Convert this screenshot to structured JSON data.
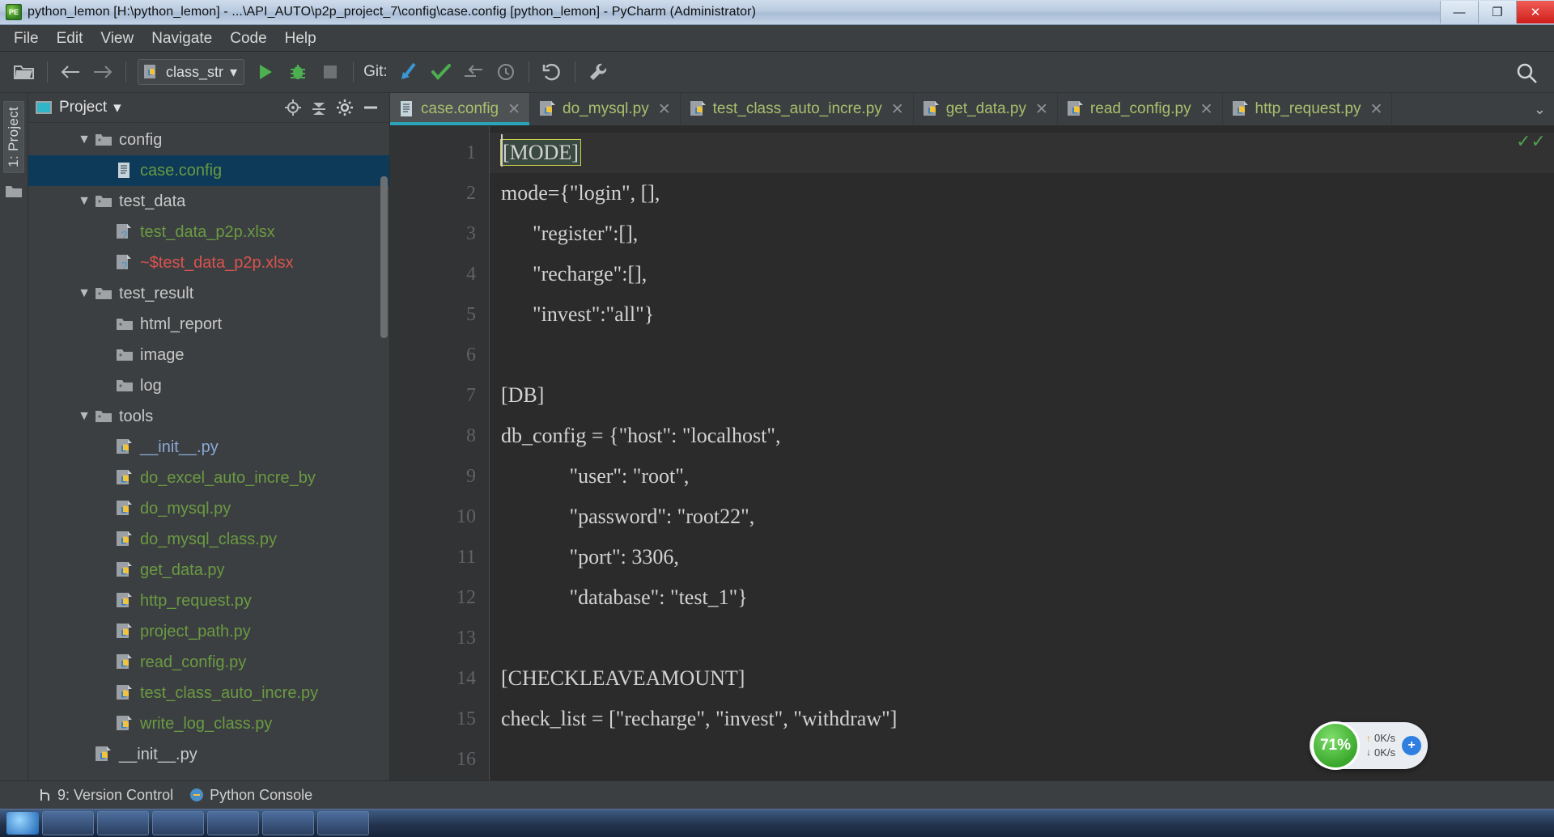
{
  "window": {
    "title": "python_lemon [H:\\python_lemon] - ...\\API_AUTO\\p2p_project_7\\config\\case.config [python_lemon] - PyCharm (Administrator)",
    "app_icon": "pycharm-icon",
    "minimize_label": "—",
    "maximize_label": "❐",
    "close_label": "✕"
  },
  "menubar": {
    "items": [
      {
        "label": "File"
      },
      {
        "label": "Edit"
      },
      {
        "label": "View"
      },
      {
        "label": "Navigate"
      },
      {
        "label": "Code"
      },
      {
        "label": "Help"
      }
    ]
  },
  "toolbar": {
    "open_label": "open-folder-icon",
    "back_label": "back-arrow-icon",
    "forward_label": "forward-arrow-icon",
    "run_config": {
      "name": "class_str",
      "icon": "python-file-icon",
      "chevron": "▾"
    },
    "run_label": "run-icon",
    "debug_label": "debug-icon",
    "stop_label": "stop-icon",
    "git_label": "Git:",
    "git_update_label": "git-update-icon",
    "git_commit_label": "git-commit-icon",
    "git_push_label": "git-push-icon",
    "git_history_label": "git-history-icon",
    "undo_label": "undo-icon",
    "wrench_label": "wrench-icon",
    "search_label": "search-icon"
  },
  "left_strip": {
    "project_tab": "1: Project",
    "folder_icon": "folder-icon"
  },
  "project_panel": {
    "title": "Project",
    "chevron": "▾",
    "panel_icon": "project-panel-icon",
    "tool_locate": "locate-icon",
    "tool_collapse": "collapse-all-icon",
    "tool_settings": "gear-icon",
    "tool_hide": "hide-icon",
    "tree": [
      {
        "label": "config",
        "indent": 2,
        "type": "folder",
        "twisty": "▼",
        "color": "grey",
        "selected": false
      },
      {
        "label": "case.config",
        "indent": 3,
        "type": "config",
        "twisty": "",
        "color": "green",
        "selected": true
      },
      {
        "label": "test_data",
        "indent": 2,
        "type": "folder",
        "twisty": "▼",
        "color": "grey",
        "selected": false
      },
      {
        "label": "test_data_p2p.xlsx",
        "indent": 3,
        "type": "excel",
        "twisty": "",
        "color": "green",
        "selected": false
      },
      {
        "label": "~$test_data_p2p.xlsx",
        "indent": 3,
        "type": "excel",
        "twisty": "",
        "color": "red",
        "selected": false
      },
      {
        "label": "test_result",
        "indent": 2,
        "type": "folder",
        "twisty": "▼",
        "color": "grey",
        "selected": false
      },
      {
        "label": "html_report",
        "indent": 3,
        "type": "folder",
        "twisty": "",
        "color": "grey",
        "selected": false
      },
      {
        "label": "image",
        "indent": 3,
        "type": "folder",
        "twisty": "",
        "color": "grey",
        "selected": false
      },
      {
        "label": "log",
        "indent": 3,
        "type": "folder",
        "twisty": "",
        "color": "grey",
        "selected": false
      },
      {
        "label": "tools",
        "indent": 2,
        "type": "folder",
        "twisty": "▼",
        "color": "grey",
        "selected": false
      },
      {
        "label": "__init__.py",
        "indent": 3,
        "type": "python",
        "twisty": "",
        "color": "blue",
        "selected": false
      },
      {
        "label": "do_excel_auto_incre_by",
        "indent": 3,
        "type": "python",
        "twisty": "",
        "color": "green",
        "selected": false
      },
      {
        "label": "do_mysql.py",
        "indent": 3,
        "type": "python",
        "twisty": "",
        "color": "green",
        "selected": false
      },
      {
        "label": "do_mysql_class.py",
        "indent": 3,
        "type": "python",
        "twisty": "",
        "color": "green",
        "selected": false
      },
      {
        "label": "get_data.py",
        "indent": 3,
        "type": "python",
        "twisty": "",
        "color": "green",
        "selected": false
      },
      {
        "label": "http_request.py",
        "indent": 3,
        "type": "python",
        "twisty": "",
        "color": "green",
        "selected": false
      },
      {
        "label": "project_path.py",
        "indent": 3,
        "type": "python",
        "twisty": "",
        "color": "green",
        "selected": false
      },
      {
        "label": "read_config.py",
        "indent": 3,
        "type": "python",
        "twisty": "",
        "color": "green",
        "selected": false
      },
      {
        "label": "test_class_auto_incre.py",
        "indent": 3,
        "type": "python",
        "twisty": "",
        "color": "green",
        "selected": false
      },
      {
        "label": "write_log_class.py",
        "indent": 3,
        "type": "python",
        "twisty": "",
        "color": "green",
        "selected": false
      },
      {
        "label": "__init__.py",
        "indent": 2,
        "type": "python",
        "twisty": "",
        "color": "grey",
        "selected": false
      }
    ]
  },
  "editor": {
    "tabs": [
      {
        "label": "case.config",
        "icon": "config-file-icon",
        "active": true,
        "close": "✕"
      },
      {
        "label": "do_mysql.py",
        "icon": "python-file-icon",
        "active": false,
        "close": "✕"
      },
      {
        "label": "test_class_auto_incre.py",
        "icon": "python-file-icon",
        "active": false,
        "close": "✕"
      },
      {
        "label": "get_data.py",
        "icon": "python-file-icon",
        "active": false,
        "close": "✕"
      },
      {
        "label": "read_config.py",
        "icon": "python-file-icon",
        "active": false,
        "close": "✕"
      },
      {
        "label": "http_request.py",
        "icon": "python-file-icon",
        "active": false,
        "close": "✕"
      }
    ],
    "tabs_overflow": "⌄",
    "line_numbers": [
      "1",
      "2",
      "3",
      "4",
      "5",
      "6",
      "7",
      "8",
      "9",
      "10",
      "11",
      "12",
      "13",
      "14",
      "15",
      "16"
    ],
    "lines": [
      {
        "text": "[MODE]",
        "caret": true,
        "section": true
      },
      {
        "text": "mode={\"login\", [],",
        "caret": false,
        "section": false
      },
      {
        "text": "      \"register\":[],",
        "caret": false,
        "section": false
      },
      {
        "text": "      \"recharge\":[],",
        "caret": false,
        "section": false
      },
      {
        "text": "      \"invest\":\"all\"}",
        "caret": false,
        "section": false
      },
      {
        "text": "",
        "caret": false,
        "section": false
      },
      {
        "text": "[DB]",
        "caret": false,
        "section": false
      },
      {
        "text": "db_config = {\"host\": \"localhost\",",
        "caret": false,
        "section": false
      },
      {
        "text": "             \"user\": \"root\",",
        "caret": false,
        "section": false
      },
      {
        "text": "             \"password\": \"root22\",",
        "caret": false,
        "section": false
      },
      {
        "text": "             \"port\": 3306,",
        "caret": false,
        "section": false
      },
      {
        "text": "             \"database\": \"test_1\"}",
        "caret": false,
        "section": false
      },
      {
        "text": "",
        "caret": false,
        "section": false
      },
      {
        "text": "[CHECKLEAVEAMOUNT]",
        "caret": false,
        "section": false
      },
      {
        "text": "check_list = [\"recharge\", \"invest\", \"withdraw\"]",
        "caret": false,
        "section": false
      },
      {
        "text": "",
        "caret": false,
        "section": false
      }
    ],
    "inspection_marker": "✓✓"
  },
  "statusbar": {
    "version_control": "9: Version Control",
    "version_control_icon": "branch-icon",
    "python_console": "Python Console",
    "python_console_icon": "python-console-icon"
  },
  "net_widget": {
    "percent": "71%",
    "up_rate": "0K/s",
    "down_rate": "0K/s",
    "up_arrow": "↑",
    "down_arrow": "↓",
    "badge": "+"
  },
  "colors": {
    "accent_tab_underline": "#2ba3b8",
    "selection": "#0d3a58",
    "green_text": "#6a9a42",
    "red_text": "#d9534f",
    "blue_text": "#8aa9d6",
    "editor_bg": "#2b2b2b",
    "panel_bg": "#3c3f41"
  }
}
